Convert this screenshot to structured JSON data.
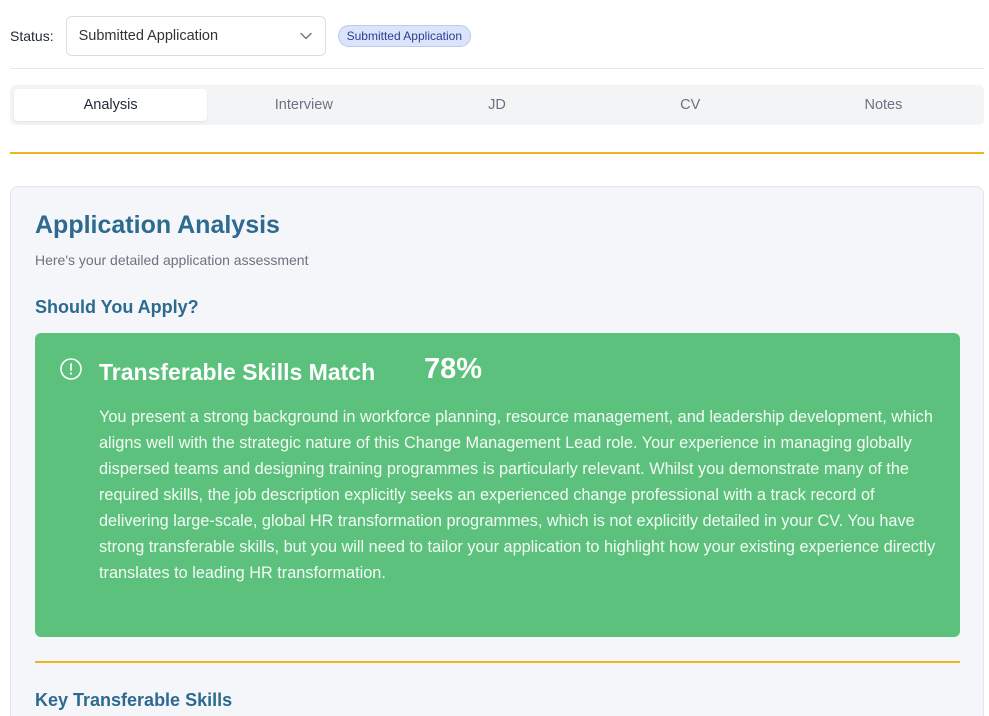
{
  "status": {
    "label": "Status:",
    "selected": "Submitted Application",
    "badge": "Submitted Application"
  },
  "tabs": [
    {
      "label": "Analysis",
      "active": true
    },
    {
      "label": "Interview",
      "active": false
    },
    {
      "label": "JD",
      "active": false
    },
    {
      "label": "CV",
      "active": false
    },
    {
      "label": "Notes",
      "active": false
    }
  ],
  "analysis": {
    "title": "Application Analysis",
    "subtitle": "Here's your detailed application assessment",
    "apply_heading": "Should You Apply?",
    "result": {
      "icon": "alert-circle-icon",
      "title": "Transferable Skills Match",
      "percentage": "78%",
      "body": "You present a strong background in workforce planning, resource management, and leadership development, which aligns well with the strategic nature of this Change Management Lead role. Your experience in managing globally dispersed teams and designing training programmes is particularly relevant. Whilst you demonstrate many of the required skills, the job description explicitly seeks an experienced change professional with a track record of delivering large-scale, global HR transformation programmes, which is not explicitly detailed in your CV. You have strong transferable skills, but you will need to tailor your application to highlight how your existing experience directly translates to leading HR transformation."
    },
    "key_skills_heading": "Key Transferable Skills"
  },
  "colors": {
    "heading": "#2c6a8f",
    "result_green": "#5cc17c",
    "accent_yellow": "#f2b521",
    "badge_bg": "#dbe4fb"
  }
}
